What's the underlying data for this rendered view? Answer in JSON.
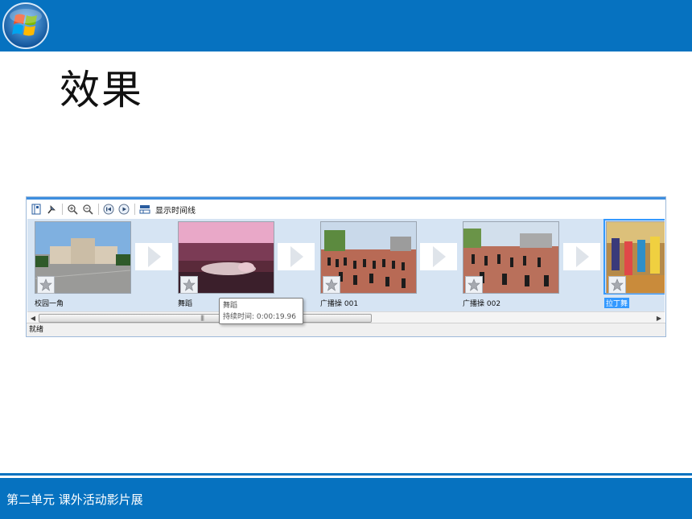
{
  "slide": {
    "title": "效果",
    "footer": "第二单元  课外活动影片展"
  },
  "colors": {
    "band": "#0672c0",
    "storyboard_bg": "#d6e4f3",
    "selection": "#3399ff"
  },
  "toolbar": {
    "icons": [
      "storyboard-icon",
      "pin-icon",
      "zoom-in-icon",
      "zoom-out-icon",
      "rewind-icon",
      "play-icon",
      "timeline-icon"
    ],
    "show_timeline_label": "显示时间线"
  },
  "clips": [
    {
      "label": "校园一角",
      "selected": false
    },
    {
      "label": "舞蹈",
      "selected": false
    },
    {
      "label": "广播操 001",
      "selected": false
    },
    {
      "label": "广播操 002",
      "selected": false
    },
    {
      "label": "拉丁舞",
      "selected": true
    }
  ],
  "tooltip": {
    "title": "舞蹈",
    "duration_label": "持续时间:",
    "duration_value": "0:00:19.96"
  },
  "scrollbar": {
    "grip": "|||"
  },
  "status": {
    "text": "就绪"
  }
}
